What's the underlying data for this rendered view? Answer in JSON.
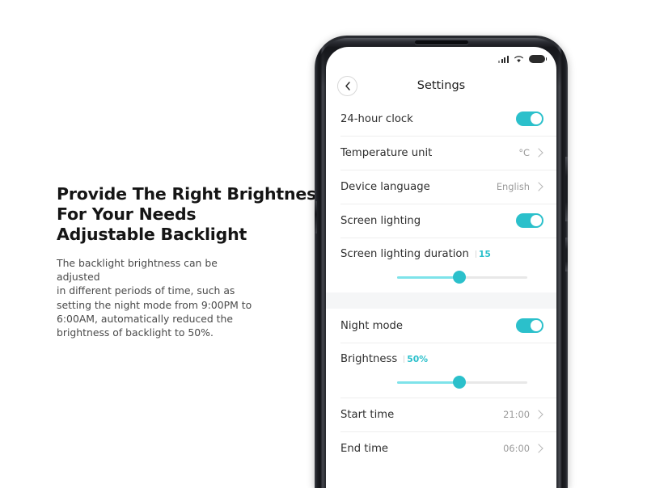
{
  "marketing": {
    "headline_lines": [
      "Provide The Right Brightness",
      "For Your Needs",
      "Adjustable Backlight"
    ],
    "body_lines": [
      "The backlight brightness can be adjusted",
      "in different periods of time, such as",
      "setting the night mode from 9:00PM to",
      "6:00AM, automatically reduced the",
      "brightness of backlight to 50%."
    ]
  },
  "phone": {
    "status_bar": {
      "signal_icon": "signal-bars-icon",
      "wifi_icon": "wifi-icon",
      "battery_icon": "battery-full-icon"
    },
    "nav": {
      "back_icon": "chevron-left-icon",
      "title": "Settings"
    },
    "sections": [
      {
        "rows": [
          {
            "type": "toggle",
            "label": "24-hour clock",
            "state": "on"
          },
          {
            "type": "value",
            "label": "Temperature unit",
            "value": "°C"
          },
          {
            "type": "value",
            "label": "Device language",
            "value": "English"
          },
          {
            "type": "toggle",
            "label": "Screen lighting",
            "state": "on"
          },
          {
            "type": "slider",
            "label": "Screen lighting duration",
            "value": "15",
            "percent": 48
          }
        ]
      },
      {
        "rows": [
          {
            "type": "toggle",
            "label": "Night mode",
            "state": "on"
          },
          {
            "type": "slider",
            "label": "Brightness",
            "value": "50%",
            "percent": 48
          },
          {
            "type": "value",
            "label": "Start time",
            "value": "21:00"
          },
          {
            "type": "value",
            "label": "End time",
            "value": "06:00"
          }
        ]
      }
    ]
  },
  "colors": {
    "accent": "#2BC0CB",
    "slider_fill": "#7EE3EA",
    "track": "#E8E8E8",
    "text_primary": "#2F2F2F",
    "text_secondary": "#9A9A9A",
    "headline": "#151515"
  }
}
